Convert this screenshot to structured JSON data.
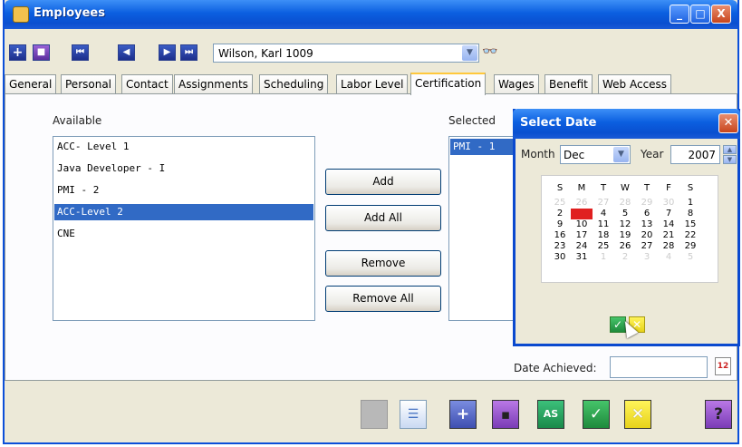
{
  "window": {
    "title": "Employees"
  },
  "titlebar_buttons": {
    "minimize": "_",
    "maximize": "□",
    "close": "X"
  },
  "toolbar": {
    "nav": {
      "first": "⏮",
      "prev": "◀",
      "next": "▶",
      "last": "⏭"
    },
    "employee_combo": {
      "value": "Wilson, Karl 1009"
    },
    "search_icon": "binoculars-icon"
  },
  "tabs": [
    "General",
    "Personal",
    "Contact",
    "Assignments",
    "Scheduling",
    "Labor Level",
    "Certification",
    "Wages",
    "Benefit",
    "Web Access"
  ],
  "active_tab": "Certification",
  "certification": {
    "available_label": "Available",
    "available_items": [
      "ACC- Level 1",
      "Java Developer - I",
      "PMI - 2",
      "ACC-Level 2",
      "CNE"
    ],
    "available_selected_index": 3,
    "selected_label": "Selected",
    "selected_items": [
      "PMI - 1"
    ],
    "buttons": {
      "add": "Add",
      "add_all": "Add All",
      "remove": "Remove",
      "remove_all": "Remove All"
    },
    "date_achieved_label": "Date Achieved:",
    "date_achieved_value": "",
    "calendar_button_text": "12"
  },
  "select_date": {
    "title": "Select Date",
    "month_label": "Month",
    "month_value": "Dec",
    "year_label": "Year",
    "year_value": "2007",
    "weekdays": [
      "S",
      "M",
      "T",
      "W",
      "T",
      "F",
      "S"
    ],
    "weeks": [
      [
        "25",
        "26",
        "27",
        "28",
        "29",
        "30",
        "1"
      ],
      [
        "2",
        "3",
        "4",
        "5",
        "6",
        "7",
        "8"
      ],
      [
        "9",
        "10",
        "11",
        "12",
        "13",
        "14",
        "15"
      ],
      [
        "16",
        "17",
        "18",
        "19",
        "20",
        "21",
        "22"
      ],
      [
        "23",
        "24",
        "25",
        "26",
        "27",
        "28",
        "29"
      ],
      [
        "30",
        "31",
        "1",
        "2",
        "3",
        "4",
        "5"
      ]
    ],
    "highlighted_day": "3",
    "ok_icon": "checkmark-icon",
    "cancel_icon": "x-icon"
  },
  "bottom_toolbar": [
    {
      "name": "disabled-button",
      "icon": "blank-icon"
    },
    {
      "name": "document-button",
      "icon": "document-icon"
    },
    {
      "name": "add-button",
      "icon": "plus-icon"
    },
    {
      "name": "save-button",
      "icon": "floppy-icon"
    },
    {
      "name": "save-as-button",
      "icon": "save-as-icon"
    },
    {
      "name": "ok-button",
      "icon": "checkmark-icon"
    },
    {
      "name": "cancel-button",
      "icon": "x-icon"
    },
    {
      "name": "help-button",
      "icon": "question-icon"
    }
  ],
  "colors": {
    "selection": "#316ac5",
    "accent_tab": "#ffc83c",
    "today_marker": "#e02020",
    "dialog_border": "#0a49cf"
  }
}
